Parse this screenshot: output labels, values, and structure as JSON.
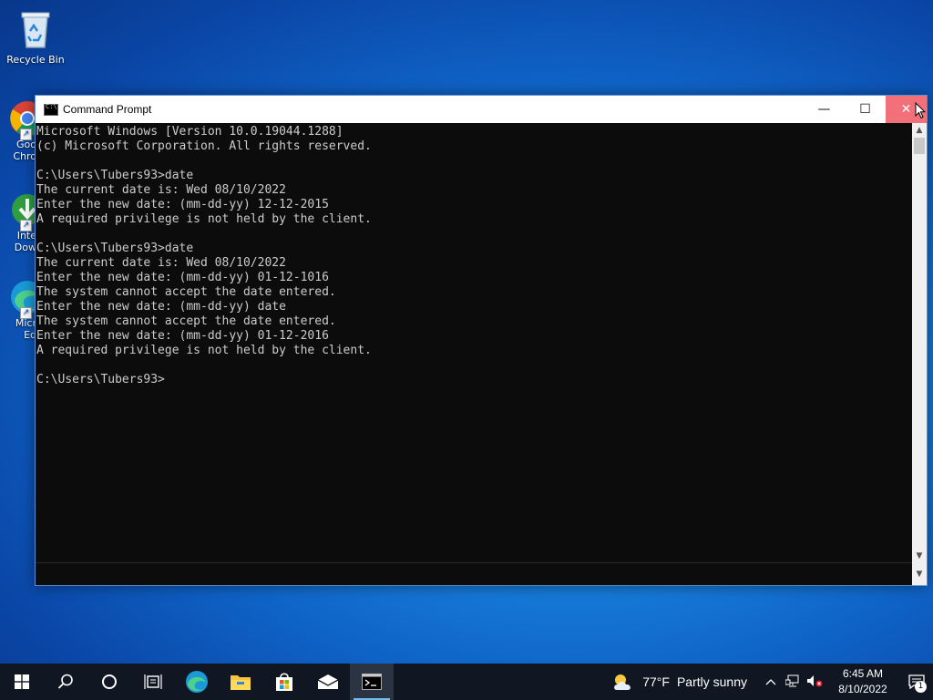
{
  "desktop": {
    "icons": [
      {
        "label": "Recycle Bin"
      },
      {
        "label": "Goo\nChro"
      },
      {
        "label": "Inte\nDow"
      },
      {
        "label": "Micr\nEd"
      }
    ]
  },
  "window": {
    "title": "Command Prompt",
    "minimize_glyph": "—",
    "maximize_glyph": "☐",
    "close_glyph": "✕",
    "lines": [
      "Microsoft Windows [Version 10.0.19044.1288]",
      "(c) Microsoft Corporation. All rights reserved.",
      "",
      "C:\\Users\\Tubers93>date",
      "The current date is: Wed 08/10/2022",
      "Enter the new date: (mm-dd-yy) 12-12-2015",
      "A required privilege is not held by the client.",
      "",
      "C:\\Users\\Tubers93>date",
      "The current date is: Wed 08/10/2022",
      "Enter the new date: (mm-dd-yy) 01-12-1016",
      "The system cannot accept the date entered.",
      "Enter the new date: (mm-dd-yy) date",
      "The system cannot accept the date entered.",
      "Enter the new date: (mm-dd-yy) 01-12-2016",
      "A required privilege is not held by the client.",
      "",
      "C:\\Users\\Tubers93>"
    ]
  },
  "taskbar": {
    "weather": {
      "temp": "77°F",
      "condition": "Partly sunny"
    },
    "clock": {
      "time": "6:45 AM",
      "date": "8/10/2022"
    },
    "notification_count": "1"
  },
  "colors": {
    "taskbar": "#101722",
    "console_bg": "#0c0c0c",
    "console_fg": "#cccccc",
    "close_hover": "#f1707a"
  }
}
